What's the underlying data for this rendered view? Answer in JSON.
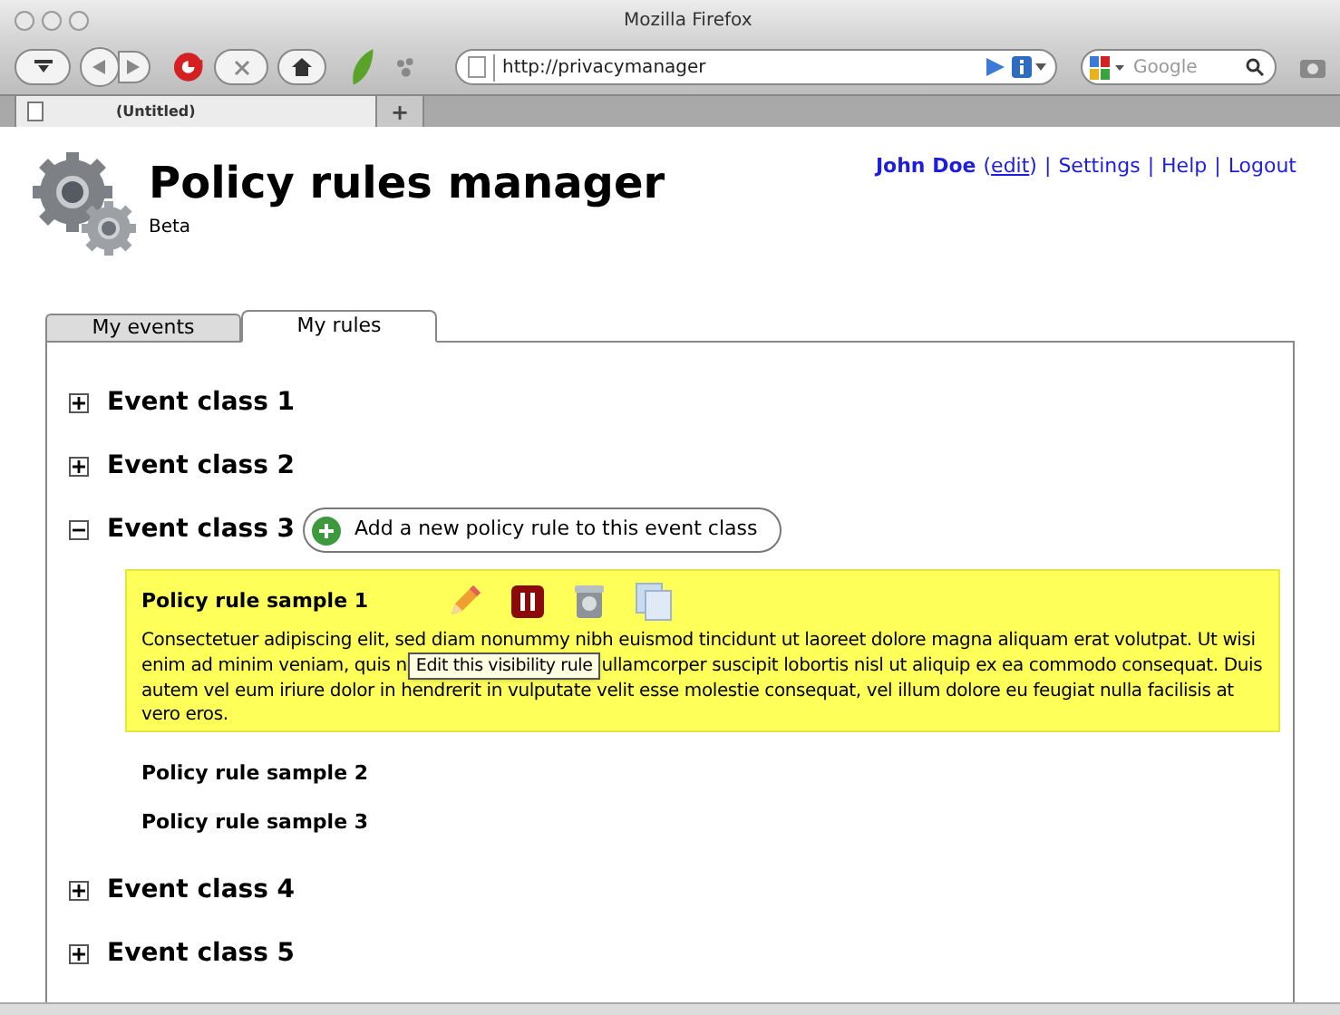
{
  "browser": {
    "title": "Mozilla Firefox",
    "url": "http://privacymanager",
    "search_placeholder": "Google",
    "tabs": [
      {
        "label": "(Untitled)",
        "selected": true
      }
    ],
    "new_tab": "+"
  },
  "header": {
    "title": "Policy rules manager",
    "subtitle": "Beta",
    "user_name": "John Doe",
    "edit_open": "(",
    "edit_link": "edit",
    "edit_close": ")",
    "links": [
      {
        "separator": "|",
        "label": "Settings"
      },
      {
        "separator": "|",
        "label": "Help"
      },
      {
        "separator": "|",
        "label": "Logout"
      }
    ]
  },
  "tabs": [
    {
      "label": "My events",
      "selected": false
    },
    {
      "label": "My rules",
      "selected": true
    }
  ],
  "event_classes": [
    {
      "label": "Event class 1",
      "expanded": false
    },
    {
      "label": "Event class 2",
      "expanded": false
    },
    {
      "label": "Event class 3",
      "expanded": true,
      "add_button": "Add a new policy rule to this event class",
      "rules": [
        {
          "title": "Policy rule sample 1",
          "selected": true,
          "description_before": "Consectetuer adipiscing elit, sed diam nonummy nibh euismod tincidunt ut laoreet dolore magna aliquam erat volutpat. Ut wisi enim ad minim veniam, quis n",
          "tooltip": "Edit this visibility rule",
          "description_after": "ullamcorper suscipit lobortis nisl ut aliquip ex ea commodo consequat. Duis autem vel eum iriure dolor in hendrerit in vulputate velit esse molestie consequat, vel illum dolore eu feugiat nulla facilisis at vero eros."
        },
        {
          "title": "Policy rule sample 2",
          "selected": false
        },
        {
          "title": "Policy rule sample 3",
          "selected": false
        }
      ]
    },
    {
      "label": "Event class 4",
      "expanded": false
    },
    {
      "label": "Event class 5",
      "expanded": false
    }
  ]
}
